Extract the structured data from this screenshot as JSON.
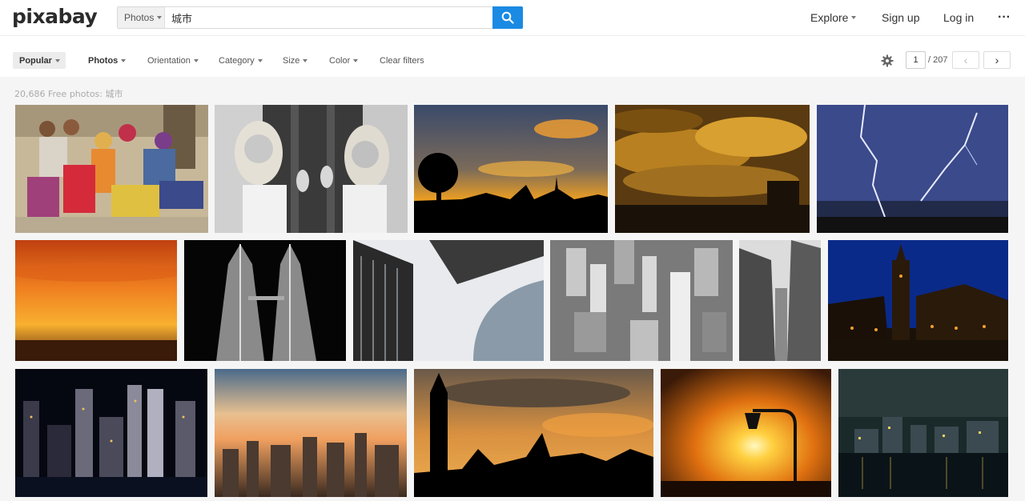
{
  "header": {
    "logo": "pixabay",
    "search_type": "Photos",
    "search_value": "城市",
    "explore": "Explore",
    "signup": "Sign up",
    "login": "Log in",
    "more": "···"
  },
  "filters": {
    "popular": "Popular",
    "photos": "Photos",
    "orientation": "Orientation",
    "category": "Category",
    "size": "Size",
    "color": "Color",
    "clear": "Clear filters"
  },
  "pagination": {
    "current": "1",
    "total": "/ 207",
    "prev": "‹",
    "next": "›"
  },
  "results": {
    "count_text": "20,686 Free photos: 城市"
  },
  "colors": {
    "accent": "#1a8ae3"
  }
}
